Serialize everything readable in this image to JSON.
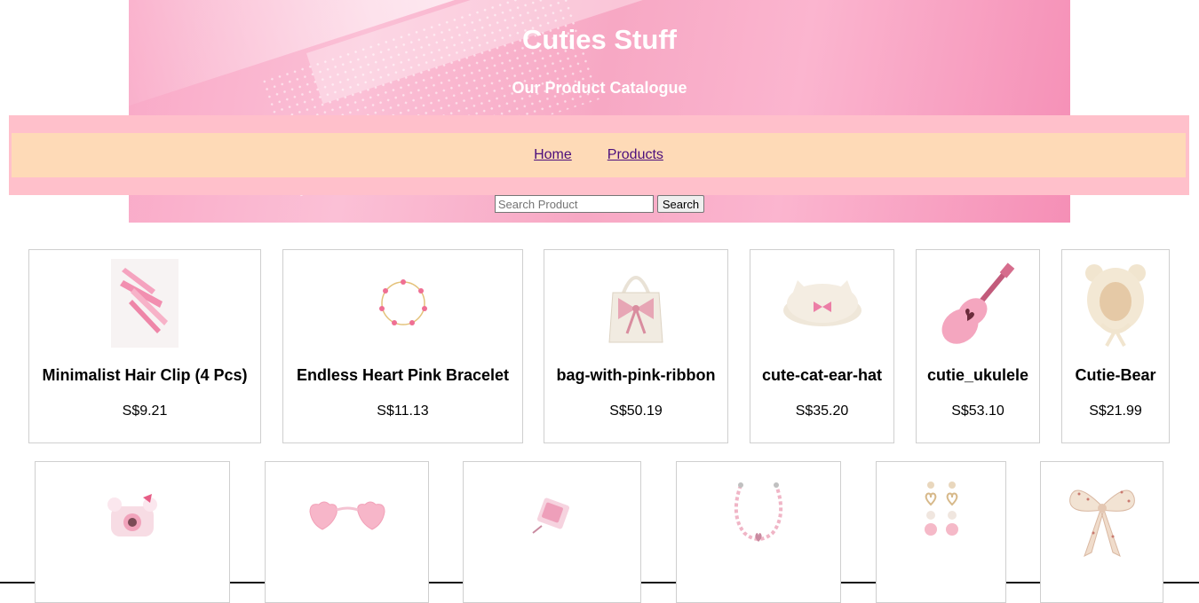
{
  "header": {
    "title": "Cuties Stuff",
    "subtitle": "Our Product Catalogue"
  },
  "nav": {
    "items": [
      {
        "label": "Home"
      },
      {
        "label": "Products"
      }
    ]
  },
  "search": {
    "placeholder": "Search Product",
    "value": "",
    "button_label": "Search"
  },
  "products_row1": [
    {
      "name": "Minimalist Hair Clip (4 Pcs)",
      "price": "S$9.21",
      "icon": "hair-clip-icon"
    },
    {
      "name": "Endless Heart Pink Bracelet",
      "price": "S$11.13",
      "icon": "bracelet-icon"
    },
    {
      "name": "bag-with-pink-ribbon",
      "price": "S$50.19",
      "icon": "bag-icon"
    },
    {
      "name": "cute-cat-ear-hat",
      "price": "S$35.20",
      "icon": "hat-icon"
    },
    {
      "name": "cutie_ukulele",
      "price": "S$53.10",
      "icon": "ukulele-icon"
    },
    {
      "name": "Cutie-Bear",
      "price": "S$21.99",
      "icon": "bear-hood-icon"
    }
  ],
  "products_row2": [
    {
      "icon": "camera-icon"
    },
    {
      "icon": "heart-sunglasses-icon"
    },
    {
      "icon": "pink-pouch-icon"
    },
    {
      "icon": "necklace-icon"
    },
    {
      "icon": "heart-earrings-icon"
    },
    {
      "icon": "hair-bow-icon"
    }
  ]
}
